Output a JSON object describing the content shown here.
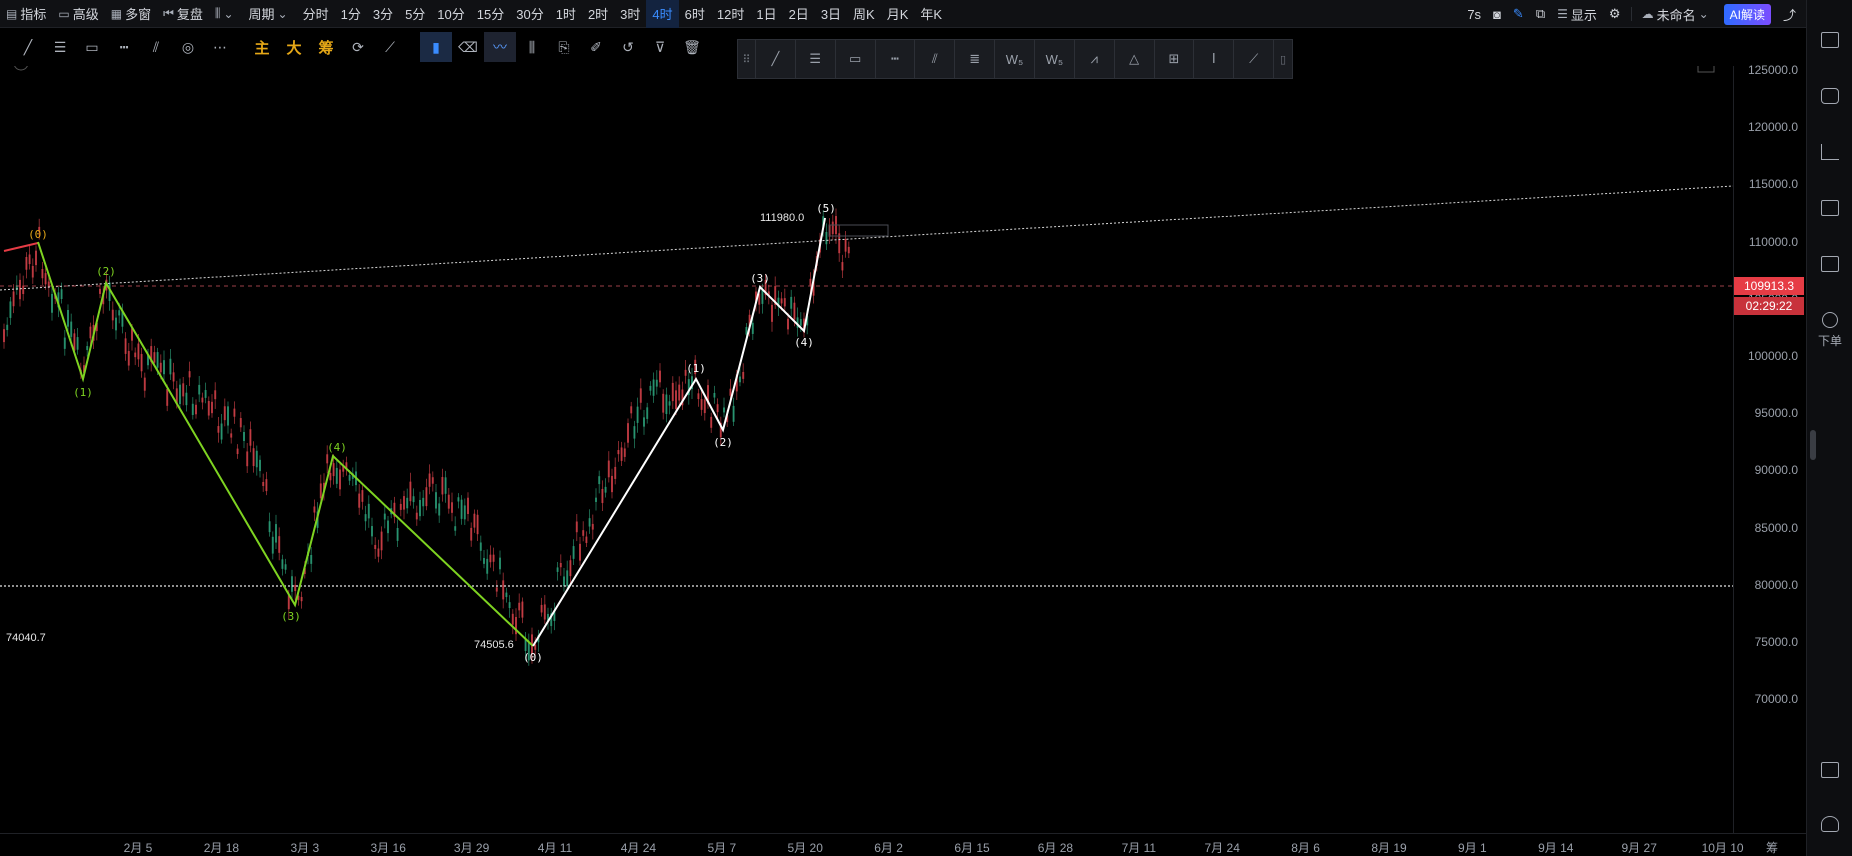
{
  "toolbar": {
    "indicators": "指标",
    "advanced": "高级",
    "multi_window": "多窗",
    "restore": "复盘",
    "chart_type_icon": "candle-icon",
    "period": "周期",
    "intervals": [
      "分时",
      "1分",
      "3分",
      "5分",
      "10分",
      "15分",
      "30分",
      "1时",
      "2时",
      "3时",
      "4时",
      "6时",
      "12时",
      "1日",
      "2日",
      "3日",
      "周K",
      "月K",
      "年K"
    ],
    "active_interval": "4时",
    "refresh": "7s",
    "display": "显示",
    "layout_name": "未命名",
    "ai_button": "AI解读"
  },
  "drawbar": {
    "main_label": "主",
    "big_label": "大",
    "chip_label": "筹"
  },
  "chart": {
    "price_line_value": "109913.3",
    "countdown": "02:29:22",
    "high_label": "111980.0",
    "low_label": "74505.6",
    "support_label": "74040.7",
    "wave_labels_green": [
      "(0)",
      "(1)",
      "(2)",
      "(3)",
      "(4)"
    ],
    "wave_labels_white": [
      "(0)",
      "(1)",
      "(2)",
      "(3)",
      "(4)",
      "(5)"
    ]
  },
  "yaxis": [
    "125000.0",
    "120000.0",
    "115000.0",
    "110000.0",
    "105000.0",
    "100000.0",
    "95000.0",
    "90000.0",
    "85000.0",
    "80000.0",
    "75000.0",
    "70000.0"
  ],
  "xaxis": [
    "2月 5",
    "2月 18",
    "3月 3",
    "3月 16",
    "3月 29",
    "4月 11",
    "4月 24",
    "5月 7",
    "5月 20",
    "6月 2",
    "6月 15",
    "6月 28",
    "7月 11",
    "7月 24",
    "8月 6",
    "8月 19",
    "9月 1",
    "9月 14",
    "9月 27",
    "10月 10",
    "筹"
  ],
  "sidebar": {
    "order": "下单"
  },
  "colors": {
    "accent": "#3a8cff",
    "up": "#2ea57d",
    "down": "#d9434b",
    "wave_green": "#7ed321",
    "wave_white": "#ffffff"
  }
}
